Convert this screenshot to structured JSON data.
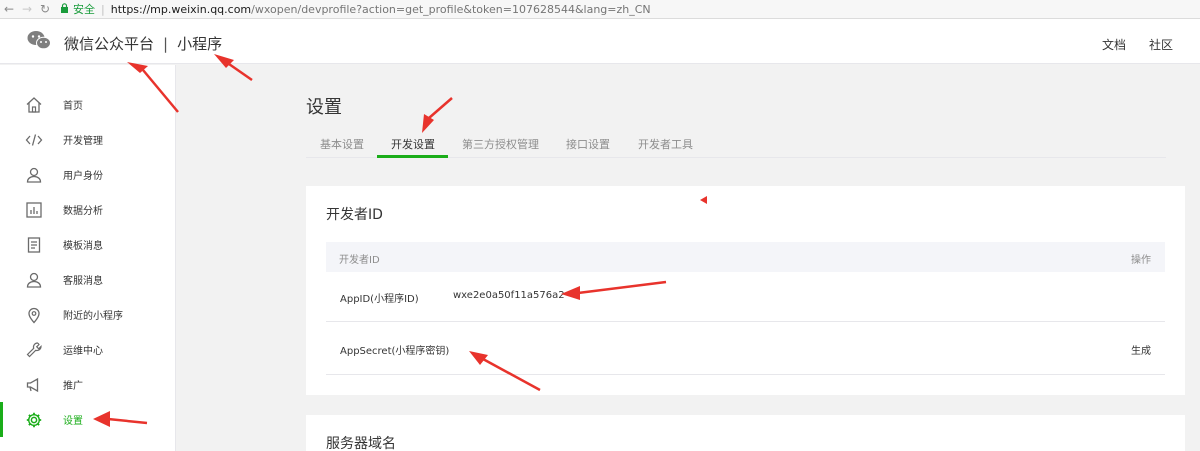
{
  "browser": {
    "secure_label": "安全",
    "url_host": "https://mp.weixin.qq.com",
    "url_path": "/wxopen/devprofile?action=get_profile&token=107628544&lang=zh_CN"
  },
  "header": {
    "platform_name": "微信公众平台",
    "separator": "|",
    "product_name": "小程序",
    "links": {
      "docs": "文档",
      "community": "社区"
    }
  },
  "sidebar": {
    "items": [
      {
        "label": "首页",
        "icon": "home-icon"
      },
      {
        "label": "开发管理",
        "icon": "code-icon"
      },
      {
        "label": "用户身份",
        "icon": "user-icon"
      },
      {
        "label": "数据分析",
        "icon": "chart-icon"
      },
      {
        "label": "模板消息",
        "icon": "document-icon"
      },
      {
        "label": "客服消息",
        "icon": "customer-service-icon"
      },
      {
        "label": "附近的小程序",
        "icon": "location-icon"
      },
      {
        "label": "运维中心",
        "icon": "wrench-icon"
      },
      {
        "label": "推广",
        "icon": "megaphone-icon"
      },
      {
        "label": "设置",
        "icon": "gear-icon",
        "active": true
      }
    ]
  },
  "main": {
    "title": "设置",
    "tabs": [
      {
        "label": "基本设置"
      },
      {
        "label": "开发设置",
        "active": true
      },
      {
        "label": "第三方授权管理"
      },
      {
        "label": "接口设置"
      },
      {
        "label": "开发者工具"
      }
    ],
    "developer_card": {
      "title": "开发者ID",
      "columns": {
        "name": "开发者ID",
        "action": "操作"
      },
      "rows": [
        {
          "name": "AppID(小程序ID)",
          "value": "wxe2e0a50f11a576a2",
          "action": ""
        },
        {
          "name": "AppSecret(小程序密钥)",
          "value": "",
          "action": "生成"
        }
      ]
    },
    "server_card": {
      "title": "服务器域名"
    }
  },
  "colors": {
    "accent": "#1aad19",
    "annotation": "#e8332c"
  }
}
